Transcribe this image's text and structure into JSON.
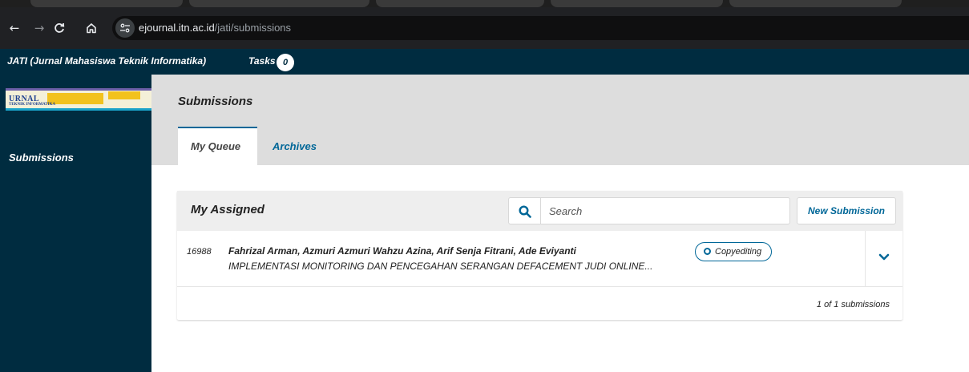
{
  "browser": {
    "url_host": "ejournal.itn.ac.id",
    "url_path": "/jati/submissions"
  },
  "header": {
    "context_title": "JATI (Jurnal Mahasiswa Teknik Informatika)",
    "tasks_label": "Tasks",
    "tasks_count": "0"
  },
  "sidebar": {
    "logo_text": "URNAL",
    "logo_subtext": "TEKNIK INFORMATIKA",
    "items": [
      {
        "label": "Submissions"
      }
    ]
  },
  "main": {
    "page_title": "Submissions",
    "tabs": [
      {
        "label": "My Queue",
        "active": true
      },
      {
        "label": "Archives",
        "active": false
      }
    ],
    "panel": {
      "title": "My Assigned",
      "search_placeholder": "Search",
      "new_submission_label": "New Submission",
      "submissions": [
        {
          "id": "16988",
          "authors": "Fahrizal Arman, Azmuri Azmuri Wahzu Azina, Arif Senja Fitrani, Ade Eviyanti",
          "title": "IMPLEMENTASI MONITORING DAN PENCEGAHAN SERANGAN DEFACEMENT JUDI ONLINE...",
          "status": "Copyediting"
        }
      ],
      "count_text": "1 of 1 submissions"
    }
  },
  "colors": {
    "brand_dark": "#002c40",
    "link_blue": "#006798"
  }
}
